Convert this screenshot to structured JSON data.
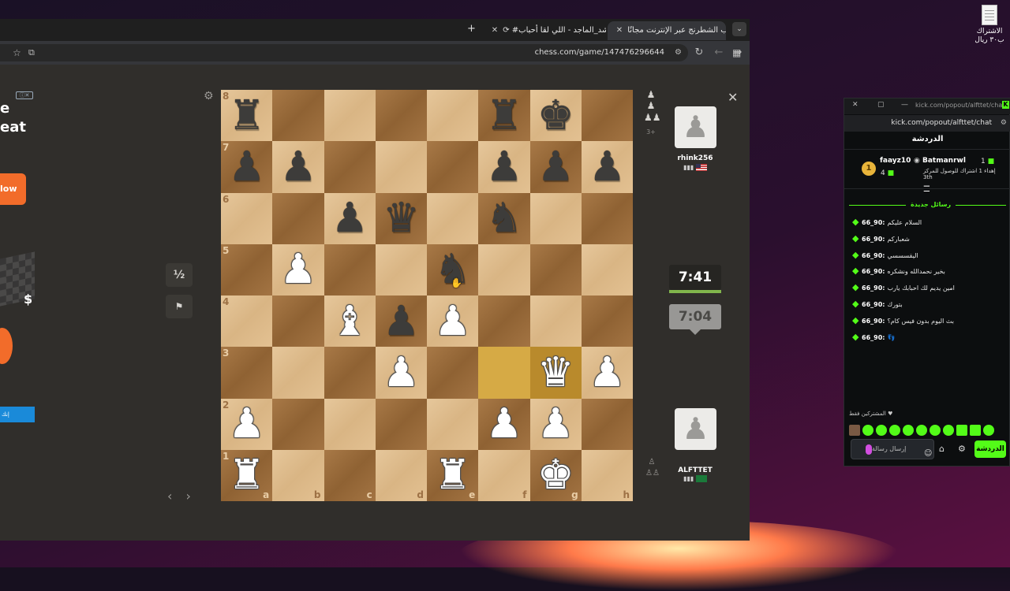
{
  "desktop": {
    "icon_label": "الاشتراك ب٣٠ ريال"
  },
  "browser": {
    "tabs": [
      {
        "label": "إلعب الشطرنج عبر الإنترنت مجانًا",
        "active": true,
        "icon": "chess-pawn-icon"
      },
      {
        "label": "#راشد_الماجد - اللي لقا أحباب",
        "active": false,
        "icon": "youtube-icon"
      }
    ],
    "new_tab": "+",
    "url": "chess.com/game/147476296644"
  },
  "ad": {
    "badge": "ⓘ✕",
    "headline": "e\neat",
    "cta": "low",
    "dollar": "$",
    "bottom_text": "إنك"
  },
  "game": {
    "board": {
      "files": [
        "a",
        "b",
        "c",
        "d",
        "e",
        "f",
        "g",
        "h"
      ],
      "ranks": [
        "8",
        "7",
        "6",
        "5",
        "4",
        "3",
        "2",
        "1"
      ],
      "highlighted": [
        "f3",
        "g3"
      ],
      "pieces": {
        "a8": "bR",
        "f8": "bR",
        "g8": "bK",
        "a7": "bP",
        "b7": "bP",
        "f7": "bP",
        "g7": "bP",
        "h7": "bP",
        "c6": "bP",
        "d6": "bQ",
        "f6": "bN",
        "b5": "wP",
        "e5": "bN",
        "c4": "wB",
        "d4": "bP",
        "e4": "wP",
        "d3": "wP",
        "g3": "wQ",
        "h3": "wP",
        "a2": "wP",
        "f2": "wP",
        "g2": "wP",
        "a1": "wR",
        "e1": "wR",
        "g1": "wK"
      }
    },
    "draw_label": "½",
    "resign_icon": "flag-icon",
    "captured": {
      "icons": [
        "♟",
        "♟",
        "♟♟"
      ],
      "count": "3+"
    },
    "top_player": {
      "name": "rhink256",
      "flag": "US"
    },
    "bottom_player": {
      "name": "ALFTTET",
      "flag": "SA"
    },
    "clock_top": "7:41",
    "clock_bottom": "7:04"
  },
  "kick": {
    "window_title": "kick.com/popout/alfttet/cha...",
    "url": "kick.com/popout/alfttet/chat",
    "chat_title": "الدردشة",
    "top_gifter": {
      "name": "faayz10",
      "count": "4"
    },
    "pinned": {
      "name": "Batmanrwl",
      "count": "1",
      "text": "إهداء 1 اشتراك للوصول للمركز",
      "rank": "3th"
    },
    "new_messages_label": "رسائل جديدة",
    "messages": [
      {
        "user": "66_90:",
        "text": "السلام عليكم"
      },
      {
        "user": "66_90:",
        "text": "شعباركم"
      },
      {
        "user": "66_90:",
        "text": "اليقسسسي"
      },
      {
        "user": "66_90:",
        "text": "بخير نحمدالله ونشكره"
      },
      {
        "user": "66_90:",
        "text": "امين يديم لك احبابك يارب"
      },
      {
        "user": "66_90:",
        "text": "بتورك"
      },
      {
        "user": "66_90:",
        "text": "بث اليوم بدون فيس كام؟"
      },
      {
        "user": "66_90:",
        "text": "👣"
      }
    ],
    "subs_only_label": "المشتركين فقط ♥",
    "input_placeholder": "إرسال رسالة",
    "chat_button": "الدردشة"
  }
}
